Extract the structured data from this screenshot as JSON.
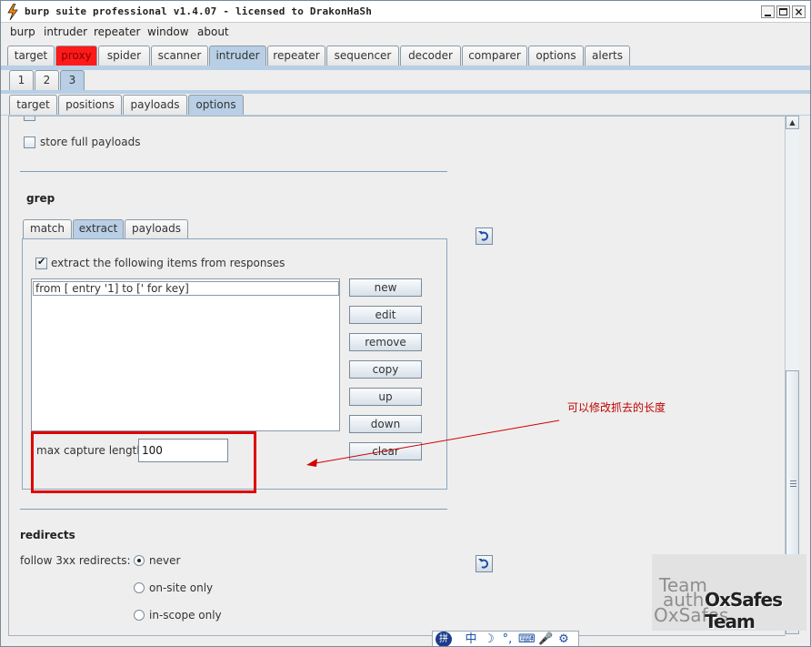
{
  "window": {
    "title": "burp suite professional v1.4.07 - licensed to DrakonHaSh",
    "minimize_glyph": "_",
    "close_glyph": "×"
  },
  "menu": [
    "burp",
    "intruder",
    "repeater",
    "window",
    "about"
  ],
  "main_tabs": [
    "target",
    "proxy",
    "spider",
    "scanner",
    "intruder",
    "repeater",
    "sequencer",
    "decoder",
    "comparer",
    "options",
    "alerts"
  ],
  "main_tab_selected": "intruder",
  "attack_tabs": [
    "1",
    "2",
    "3"
  ],
  "attack_tab_selected": "3",
  "intruder_tabs": [
    "target",
    "positions",
    "payloads",
    "options"
  ],
  "intruder_tab_selected": "options",
  "store_full_payloads": {
    "label": "store full payloads",
    "checked": false
  },
  "grep": {
    "heading": "grep",
    "tabs": [
      "match",
      "extract",
      "payloads"
    ],
    "selected_tab": "extract",
    "extract_checkbox": {
      "label": "extract the following items from responses",
      "checked": true
    },
    "items": [
      "from [ entry '1] to [' for key]"
    ],
    "buttons": [
      "new",
      "edit",
      "remove",
      "copy",
      "up",
      "down",
      "clear"
    ],
    "max_capture_label": "max capture length:",
    "max_capture_value": "100"
  },
  "redirects": {
    "heading": "redirects",
    "follow_label": "follow 3xx redirects:",
    "options": [
      "never",
      "on-site only",
      "in-scope only"
    ],
    "selected": "never"
  },
  "annotation": "可以修改抓去的长度",
  "watermark": {
    "line1": "Team",
    "line2": "auth",
    "line3": "OxSafes",
    "brand": "OxSafes Team"
  },
  "ime_toolbar": {
    "logo": "拼",
    "items": [
      "中",
      "☽",
      "°,",
      "⌨",
      "🎤",
      "⚙"
    ]
  },
  "colors": {
    "selected_tab": "#b8cfe5",
    "proxy_tab": "#ff1a1a",
    "annotation": "#c00000",
    "highlight_box": "#e00000"
  }
}
